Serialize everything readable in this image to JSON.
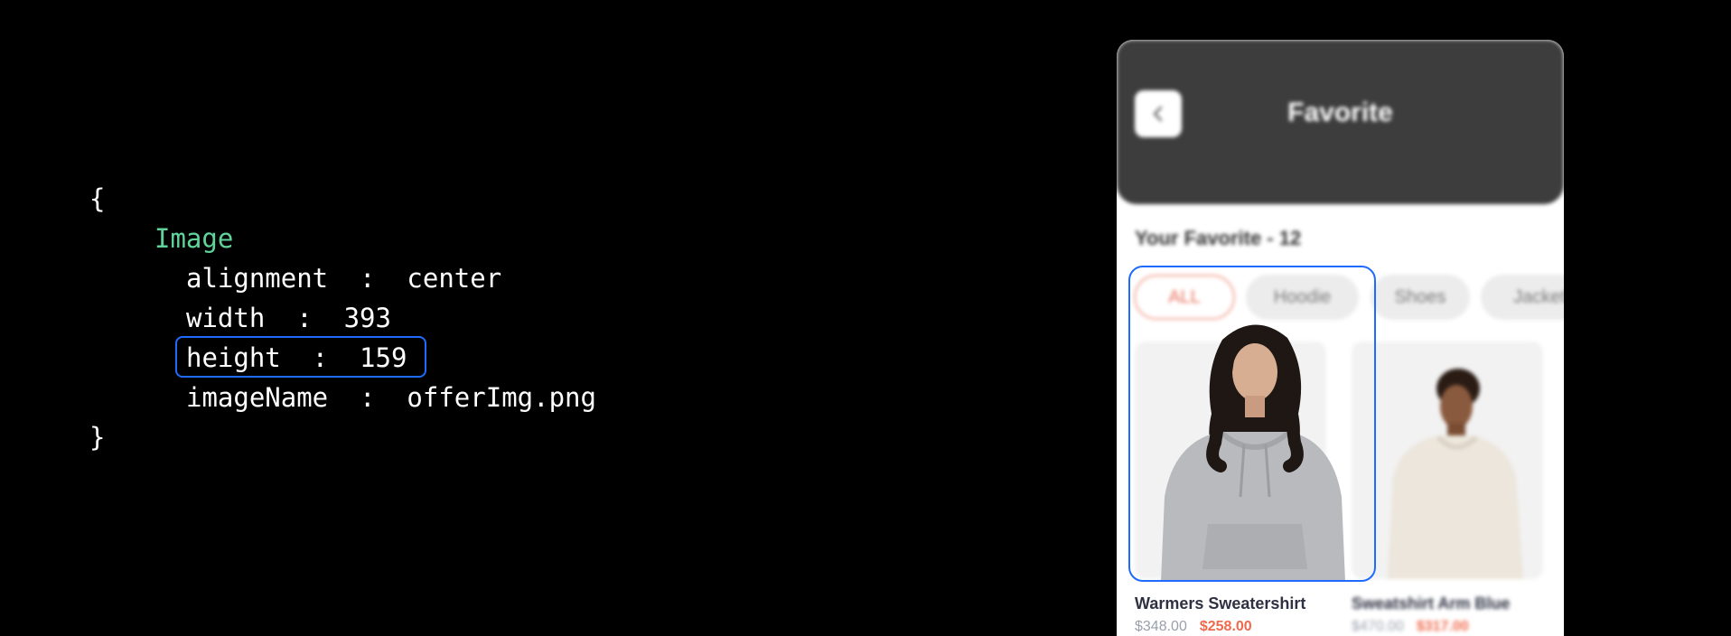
{
  "code": {
    "open_brace": "{",
    "component": "Image",
    "alignment_line": "alignment  :  center",
    "width_line": "width  :  393",
    "height_line": "height  :  159",
    "image_name_line": "imageName  :  offerImg.png",
    "close_brace": "}"
  },
  "phone": {
    "header": {
      "title": "Favorite",
      "back_icon": "chevron-left-icon"
    },
    "favorites_title": "Your Favorite - 12",
    "chips": [
      {
        "label": "ALL",
        "active": true
      },
      {
        "label": "Hoodie",
        "active": false
      },
      {
        "label": "Shoes",
        "active": false
      },
      {
        "label": "Jacket",
        "active": false
      }
    ],
    "products": [
      {
        "name": "Warmers Sweatershirt",
        "old_price": "$348.00",
        "price": "$258.00"
      },
      {
        "name": "Sweatshirt Arm Blue",
        "old_price": "$470.00",
        "price": "$317.00"
      }
    ]
  },
  "colors": {
    "background": "#000000",
    "code_text": "#ffffff",
    "component_name": "#5fd39a",
    "highlight": "#1f6bff",
    "header_bg": "#3d3d3d",
    "price": "#ef6a4d",
    "old_price": "#9aa0ab"
  }
}
